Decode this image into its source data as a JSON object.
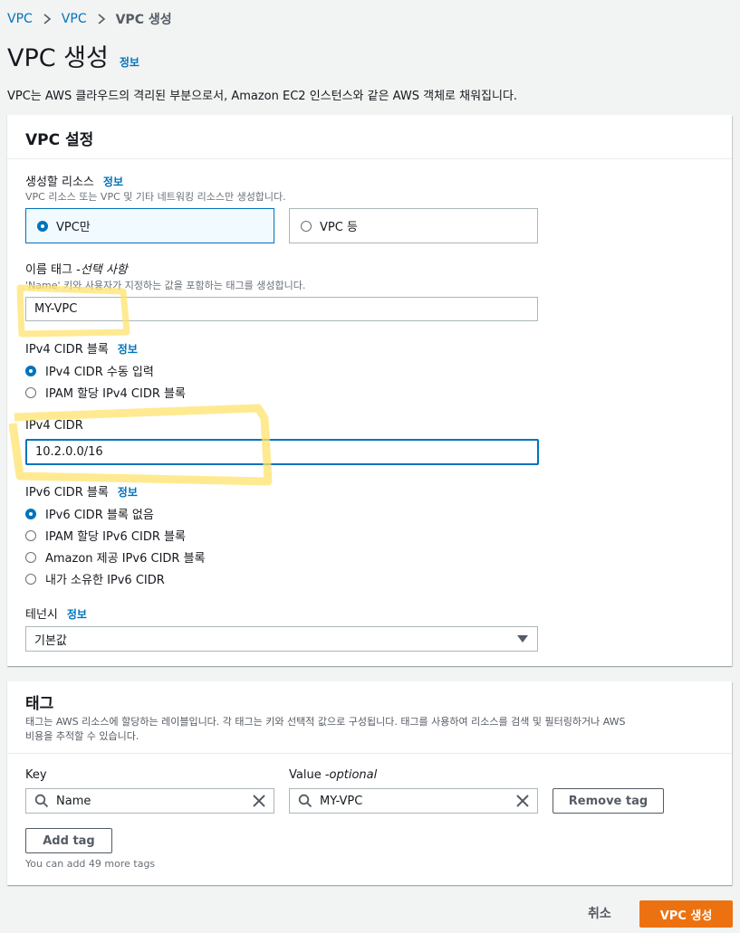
{
  "breadcrumb": {
    "items": [
      "VPC",
      "VPC"
    ],
    "current": "VPC 생성"
  },
  "page": {
    "title": "VPC 생성",
    "info": "정보",
    "description": "VPC는 AWS 클라우드의 격리된 부분으로서, Amazon EC2 인스턴스와 같은 AWS 객체로 채워집니다."
  },
  "vpc_settings": {
    "title": "VPC 설정",
    "resources": {
      "label": "생성할 리소스",
      "info": "정보",
      "hint": "VPC 리소스 또는 VPC 및 기타 네트워킹 리소스만 생성합니다.",
      "options": [
        "VPC만",
        "VPC 등"
      ],
      "selected": "VPC만"
    },
    "name_tag": {
      "label": "이름 태그 - ",
      "label_optional": "선택 사항",
      "hint": "'Name' 키와 사용자가 지정하는 값을 포함하는 태그를 생성합니다.",
      "value": "MY-VPC"
    },
    "ipv4_block": {
      "label": "IPv4 CIDR 블록",
      "info": "정보",
      "options": [
        "IPv4 CIDR 수동 입력",
        "IPAM 할당 IPv4 CIDR 블록"
      ],
      "selected": "IPv4 CIDR 수동 입력"
    },
    "ipv4_cidr": {
      "label": "IPv4 CIDR",
      "value": "10.2.0.0/16"
    },
    "ipv6_block": {
      "label": "IPv6 CIDR 블록",
      "info": "정보",
      "options": [
        "IPv6 CIDR 블록 없음",
        "IPAM 할당 IPv6 CIDR 블록",
        "Amazon 제공 IPv6 CIDR 블록",
        "내가 소유한 IPv6 CIDR"
      ],
      "selected": "IPv6 CIDR 블록 없음"
    },
    "tenancy": {
      "label": "테넌시",
      "info": "정보",
      "value": "기본값"
    }
  },
  "tags": {
    "title": "태그",
    "description_line1": "태그는 AWS 리소스에 할당하는 레이블입니다. 각 태그는 키와 선택적 값으로 구성됩니다. 태그를 사용하여 리소스를 검색 및 필터링하거나 AWS",
    "description_line2": "비용을 추적할 수 있습니다.",
    "key_label": "Key",
    "value_label": "Value - ",
    "value_optional": "optional",
    "rows": [
      {
        "key": "Name",
        "value": "MY-VPC"
      }
    ],
    "remove_label": "Remove tag",
    "add_label": "Add tag",
    "remaining": "You can add 49 more tags"
  },
  "footer": {
    "cancel": "취소",
    "create": "VPC 생성"
  },
  "colors": {
    "accent": "#0073bb",
    "primary": "#ec7211",
    "highlight": "#ffe36e"
  }
}
